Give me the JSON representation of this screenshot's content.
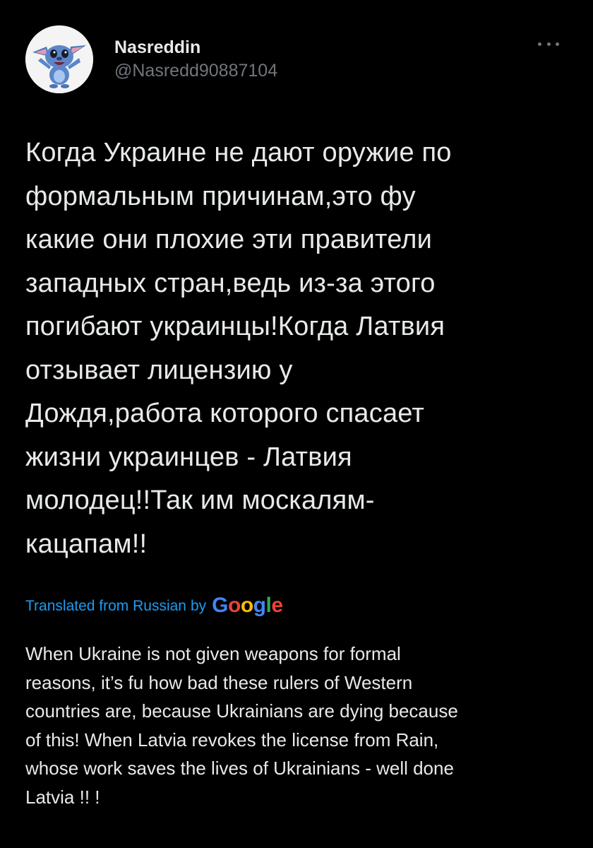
{
  "author": {
    "display_name": "Nasreddin",
    "handle": "@Nasredd90887104",
    "avatar_icon": "stitch-avatar-icon"
  },
  "more_icon": "ellipsis-icon",
  "tweet_text_lines": [
    "Когда Украине не дают оружие по",
    "формальным причинам,это фу",
    "какие они плохие эти правители",
    "западных стран,ведь из-за этого",
    "погибают украинцы!Когда Латвия",
    "отзывает лицензию у",
    "Дождя,работа которого спасает",
    "жизни украинцев - Латвия",
    "молодец!!Так им москалям-",
    "кацапам!!"
  ],
  "translation_notice": {
    "prefix": "Translated from Russian",
    "by": "by",
    "provider_letters": [
      "G",
      "o",
      "o",
      "g",
      "l",
      "e"
    ],
    "provider_colors": [
      "#4285F4",
      "#EA4335",
      "#FBBC05",
      "#4285F4",
      "#34A853",
      "#EA4335"
    ]
  },
  "translation_lines": [
    "When Ukraine is not given weapons for formal",
    "reasons, it’s fu how bad these rulers of Western",
    "countries are, because Ukrainians are dying because",
    "of this! When Latvia revokes the license from Rain,",
    "whose work saves the lives of Ukrainians - well done",
    "Latvia !! !"
  ],
  "colors": {
    "background": "#000000",
    "primary_text": "#e7e9ea",
    "secondary_text": "#71767b",
    "link": "#1d9bf0"
  }
}
